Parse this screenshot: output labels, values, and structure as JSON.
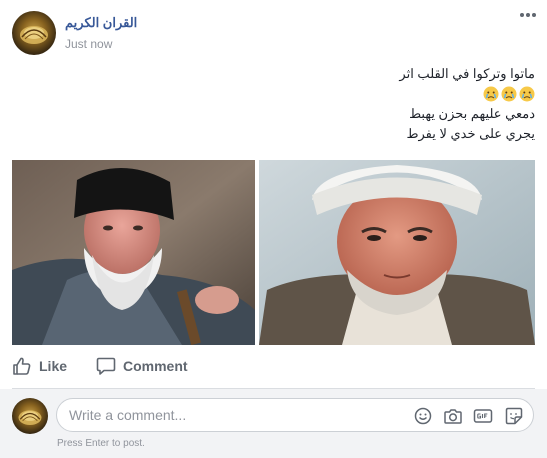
{
  "post": {
    "page_name": "القران الكريم",
    "timestamp": "Just now",
    "more_icon": "more-horizontal-icon",
    "text_lines": [
      "ماتوا وتركوا في القلب اثر",
      "دمعي عليهم بحزن يهبط",
      "يجري على خدي لا يفرط"
    ],
    "emojis": [
      "crying-face-emoji",
      "crying-face-emoji",
      "crying-face-emoji"
    ],
    "photo": "two-portraits-of-elderly-clerics"
  },
  "actions": {
    "like_label": "Like",
    "comment_label": "Comment",
    "like_icon": "thumbs-up-icon",
    "comment_icon": "speech-bubble-icon"
  },
  "comment_composer": {
    "placeholder": "Write a comment...",
    "hint": "Press Enter to post.",
    "icons": [
      "emoji-icon",
      "camera-icon",
      "gif-icon",
      "sticker-icon"
    ]
  },
  "colors": {
    "link_blue": "#385898",
    "text": "#1d2129",
    "secondary_text": "#90949c",
    "action_gray": "#606770",
    "composer_bg": "#f2f3f5"
  }
}
